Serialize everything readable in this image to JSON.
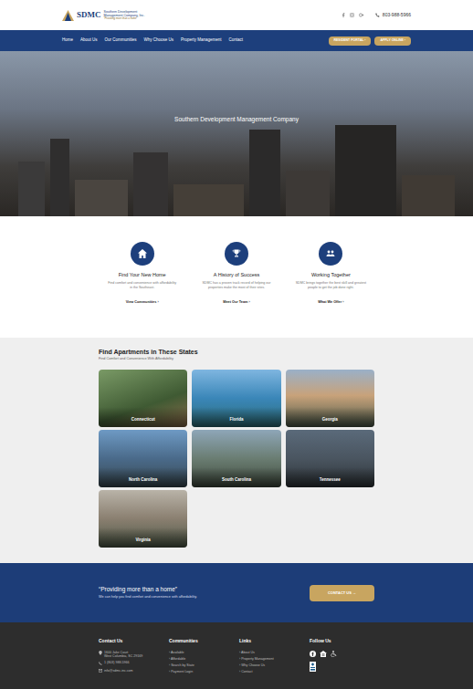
{
  "header": {
    "logo_mark": "SDMC",
    "company": "Southern Development Management Company, Inc.",
    "tagline": "\"Providing more than a home\"",
    "phone": "803-988-5966"
  },
  "nav": {
    "links": [
      "Home",
      "About Us",
      "Our Communities",
      "Why Choose Us",
      "Property Management",
      "Contact"
    ],
    "buttons": [
      "RESIDENT PORTAL ›",
      "APPLY ONLINE ›"
    ]
  },
  "hero": {
    "title": "Southern Development Management Company"
  },
  "features": [
    {
      "title": "Find Your New Home",
      "description": "Find comfort and convenience with affordability in the Southeast.",
      "link": "View Communities ›"
    },
    {
      "title": "A History of Success",
      "description": "SDMC has a proven track record of helping our properties make the most of their sites.",
      "link": "Meet Our Team ›"
    },
    {
      "title": "Working Together",
      "description": "SDMC brings together the best skill and greatest people to get the job done right.",
      "link": "What We Offer ›"
    }
  ],
  "states": {
    "title": "Find Apartments in These States",
    "subtitle": "Find Comfort and Convenience With Affordability",
    "items": [
      "Connecticut",
      "Florida",
      "Georgia",
      "North Carolina",
      "South Carolina",
      "Tennessee",
      "Virginia"
    ]
  },
  "cta": {
    "quote": "“Providing more than a home”",
    "text": "We can help you find comfort and convenience with affordability.",
    "button": "CONTACT US →"
  },
  "footer": {
    "contact": {
      "title": "Contact Us",
      "address": [
        "1600 Jake Court",
        "West Columbia, SC 29169"
      ],
      "phone": "1 (803) 988-5966",
      "email": "info@sdmc-inc.com"
    },
    "communities": {
      "title": "Communities",
      "items": [
        "› Available",
        "› Affordable",
        "› Search by State",
        "› Payment Login"
      ]
    },
    "links": {
      "title": "Links",
      "items": [
        "› About Us",
        "› Property Management",
        "› Why Choose Us",
        "› Contact"
      ]
    },
    "follow": {
      "title": "Follow Us"
    }
  }
}
